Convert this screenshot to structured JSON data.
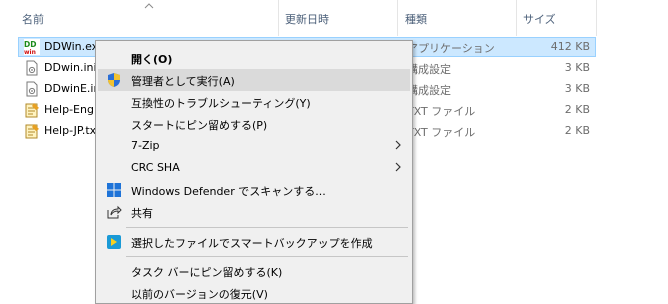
{
  "columns": {
    "name": "名前",
    "modified": "更新日時",
    "type": "種類",
    "size": "サイズ"
  },
  "files": [
    {
      "name": "DDWin.exe",
      "type": "アプリケーション",
      "size": "412 KB",
      "icon": "ddwin-app-icon",
      "selected": true
    },
    {
      "name": "DDwin.ini",
      "type": "構成設定",
      "size": "3 KB",
      "icon": "ini-file-icon"
    },
    {
      "name": "DDwinE.ini",
      "type": "構成設定",
      "size": "3 KB",
      "icon": "ini-file-icon"
    },
    {
      "name": "Help-Eng",
      "type": "TXT ファイル",
      "size": "2 KB",
      "icon": "text-file-icon"
    },
    {
      "name": "Help-JP.txt",
      "type": "TXT ファイル",
      "size": "2 KB",
      "icon": "text-file-icon"
    }
  ],
  "context_menu": {
    "open": "開く(O)",
    "run_as_admin": "管理者として実行(A)",
    "troubleshoot": "互換性のトラブルシューティング(Y)",
    "pin_start": "スタートにピン留めする(P)",
    "seven_zip": "7-Zip",
    "crc_sha": "CRC SHA",
    "defender": "Windows Defender でスキャンする...",
    "share": "共有",
    "smart_backup": "選択したファイルでスマートバックアップを作成",
    "pin_taskbar": "タスク バーにピン留めする(K)",
    "restore_previous": "以前のバージョンの復元(V)"
  },
  "colors": {
    "selection": "#cce8ff",
    "menu_background": "#f0f0f0",
    "menu_highlight": "#dadada",
    "header_text": "#4c607a"
  }
}
